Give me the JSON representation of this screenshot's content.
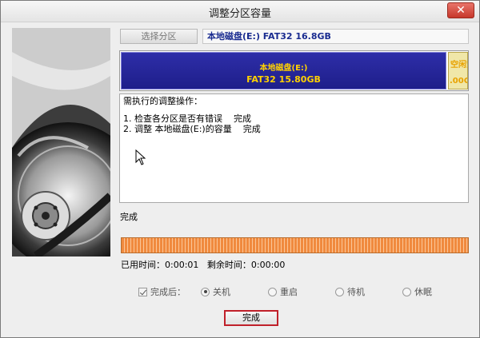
{
  "window": {
    "title": "调整分区容量",
    "close_glyph": "✕"
  },
  "partition": {
    "select_label": "选择分区",
    "name": "本地磁盘(E:) FAT32 16.8GB"
  },
  "disk_map": {
    "main_name": "本地磁盘(E:)",
    "main_info": "FAT32 15.80GB",
    "main_color": "#1e1e8a",
    "main_text_color": "#ffd100",
    "free_label": "空闲空",
    "free_size": ".00G",
    "free_color": "#f0e7a8"
  },
  "operations": {
    "header": "需执行的调整操作：",
    "items": [
      "1. 检查各分区是否有错误    完成",
      "2. 调整 本地磁盘(E:)的容量    完成"
    ]
  },
  "status_text": "完成",
  "progress_percent": 100,
  "timers": {
    "elapsed_label": "已用时间：",
    "elapsed_value": "0:00:01",
    "remaining_label": "剩余时间：",
    "remaining_value": "0:00:00"
  },
  "after_done": {
    "checkbox_label": "完成后：",
    "options": [
      "关机",
      "重启",
      "待机",
      "休眠"
    ],
    "selected": "关机"
  },
  "done_button": "完成"
}
